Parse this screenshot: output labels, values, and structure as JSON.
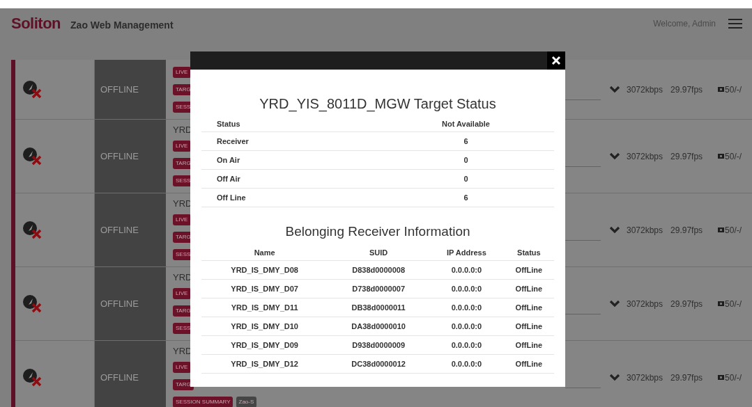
{
  "header": {
    "logo": "Soliton",
    "app_title": "Zao Web Management",
    "welcome": "Welcome, Admin"
  },
  "rows": [
    {
      "status": "OFFLINE",
      "tag_lines": [
        [
          {
            "label": "LIVE",
            "color": "#6b1128"
          }
        ],
        [
          {
            "label": "TARG",
            "color": "#6b1128"
          }
        ],
        [
          {
            "label": "SESS",
            "color": "#6b1128"
          }
        ]
      ],
      "bitrate": "3072kbps",
      "fps": "29.97fps",
      "battery": "50/-/"
    },
    {
      "name": "YRD",
      "status": "OFFLINE",
      "tag_lines": [
        [
          {
            "label": "LIVE",
            "color": "#6b1128"
          }
        ],
        [
          {
            "label": "TARG",
            "color": "#6b1128"
          }
        ],
        [
          {
            "label": "SESS",
            "color": "#6b1128"
          }
        ]
      ],
      "bitrate": "3072kbps",
      "fps": "29.97fps",
      "battery": "50/-/"
    },
    {
      "name": "YRD",
      "status": "OFFLINE",
      "tag_lines": [
        [
          {
            "label": "LIVE",
            "color": "#6b1128"
          }
        ],
        [
          {
            "label": "TARG",
            "color": "#6b1128"
          }
        ],
        [
          {
            "label": "SESS",
            "color": "#6b1128"
          }
        ]
      ],
      "bitrate": "3072kbps",
      "fps": "29.97fps",
      "battery": "50/-/"
    },
    {
      "name": "YRD",
      "status": "OFFLINE",
      "tag_lines": [
        [
          {
            "label": "LIVE",
            "color": "#6b1128"
          }
        ],
        [
          {
            "label": "TARG",
            "color": "#6b1128"
          }
        ],
        [
          {
            "label": "SESS",
            "color": "#6b1128"
          }
        ]
      ],
      "bitrate": "3072kbps",
      "fps": "29.97fps",
      "battery": "50/-/"
    },
    {
      "name": "YRD",
      "status": "OFFLINE",
      "tag_lines": [
        [
          {
            "label": "LIVE",
            "color": "#6b1128"
          }
        ],
        [
          {
            "label": "TARG",
            "color": "#6b1128"
          }
        ],
        [
          {
            "label": "SESSION SUMMARY",
            "color": "#6b1128"
          },
          {
            "label": "Zao-S",
            "color": "#454545"
          }
        ]
      ],
      "bitrate": "3072kbps",
      "fps": "29.97fps",
      "battery": "50/-/"
    }
  ],
  "modal": {
    "title": "YRD_YIS_8011D_MGW Target Status",
    "status_table": {
      "columns": [
        "Status",
        "Not Available"
      ],
      "rows": [
        [
          "Receiver",
          "6"
        ],
        [
          "On Air",
          "0"
        ],
        [
          "Off Air",
          "0"
        ],
        [
          "Off Line",
          "6"
        ]
      ]
    },
    "receivers_title": "Belonging Receiver Information",
    "receivers": {
      "columns": [
        "Name",
        "SUID",
        "IP Address",
        "Status"
      ],
      "rows": [
        [
          "YRD_IS_DMY_D08",
          "D838d0000008",
          "0.0.0.0:0",
          "OffLine"
        ],
        [
          "YRD_IS_DMY_D07",
          "D738d0000007",
          "0.0.0.0:0",
          "OffLine"
        ],
        [
          "YRD_IS_DMY_D11",
          "DB38d0000011",
          "0.0.0.0:0",
          "OffLine"
        ],
        [
          "YRD_IS_DMY_D10",
          "DA38d0000010",
          "0.0.0.0:0",
          "OffLine"
        ],
        [
          "YRD_IS_DMY_D09",
          "D938d0000009",
          "0.0.0.0:0",
          "OffLine"
        ],
        [
          "YRD_IS_DMY_D12",
          "DC38d0000012",
          "0.0.0.0:0",
          "OffLine"
        ]
      ]
    }
  }
}
